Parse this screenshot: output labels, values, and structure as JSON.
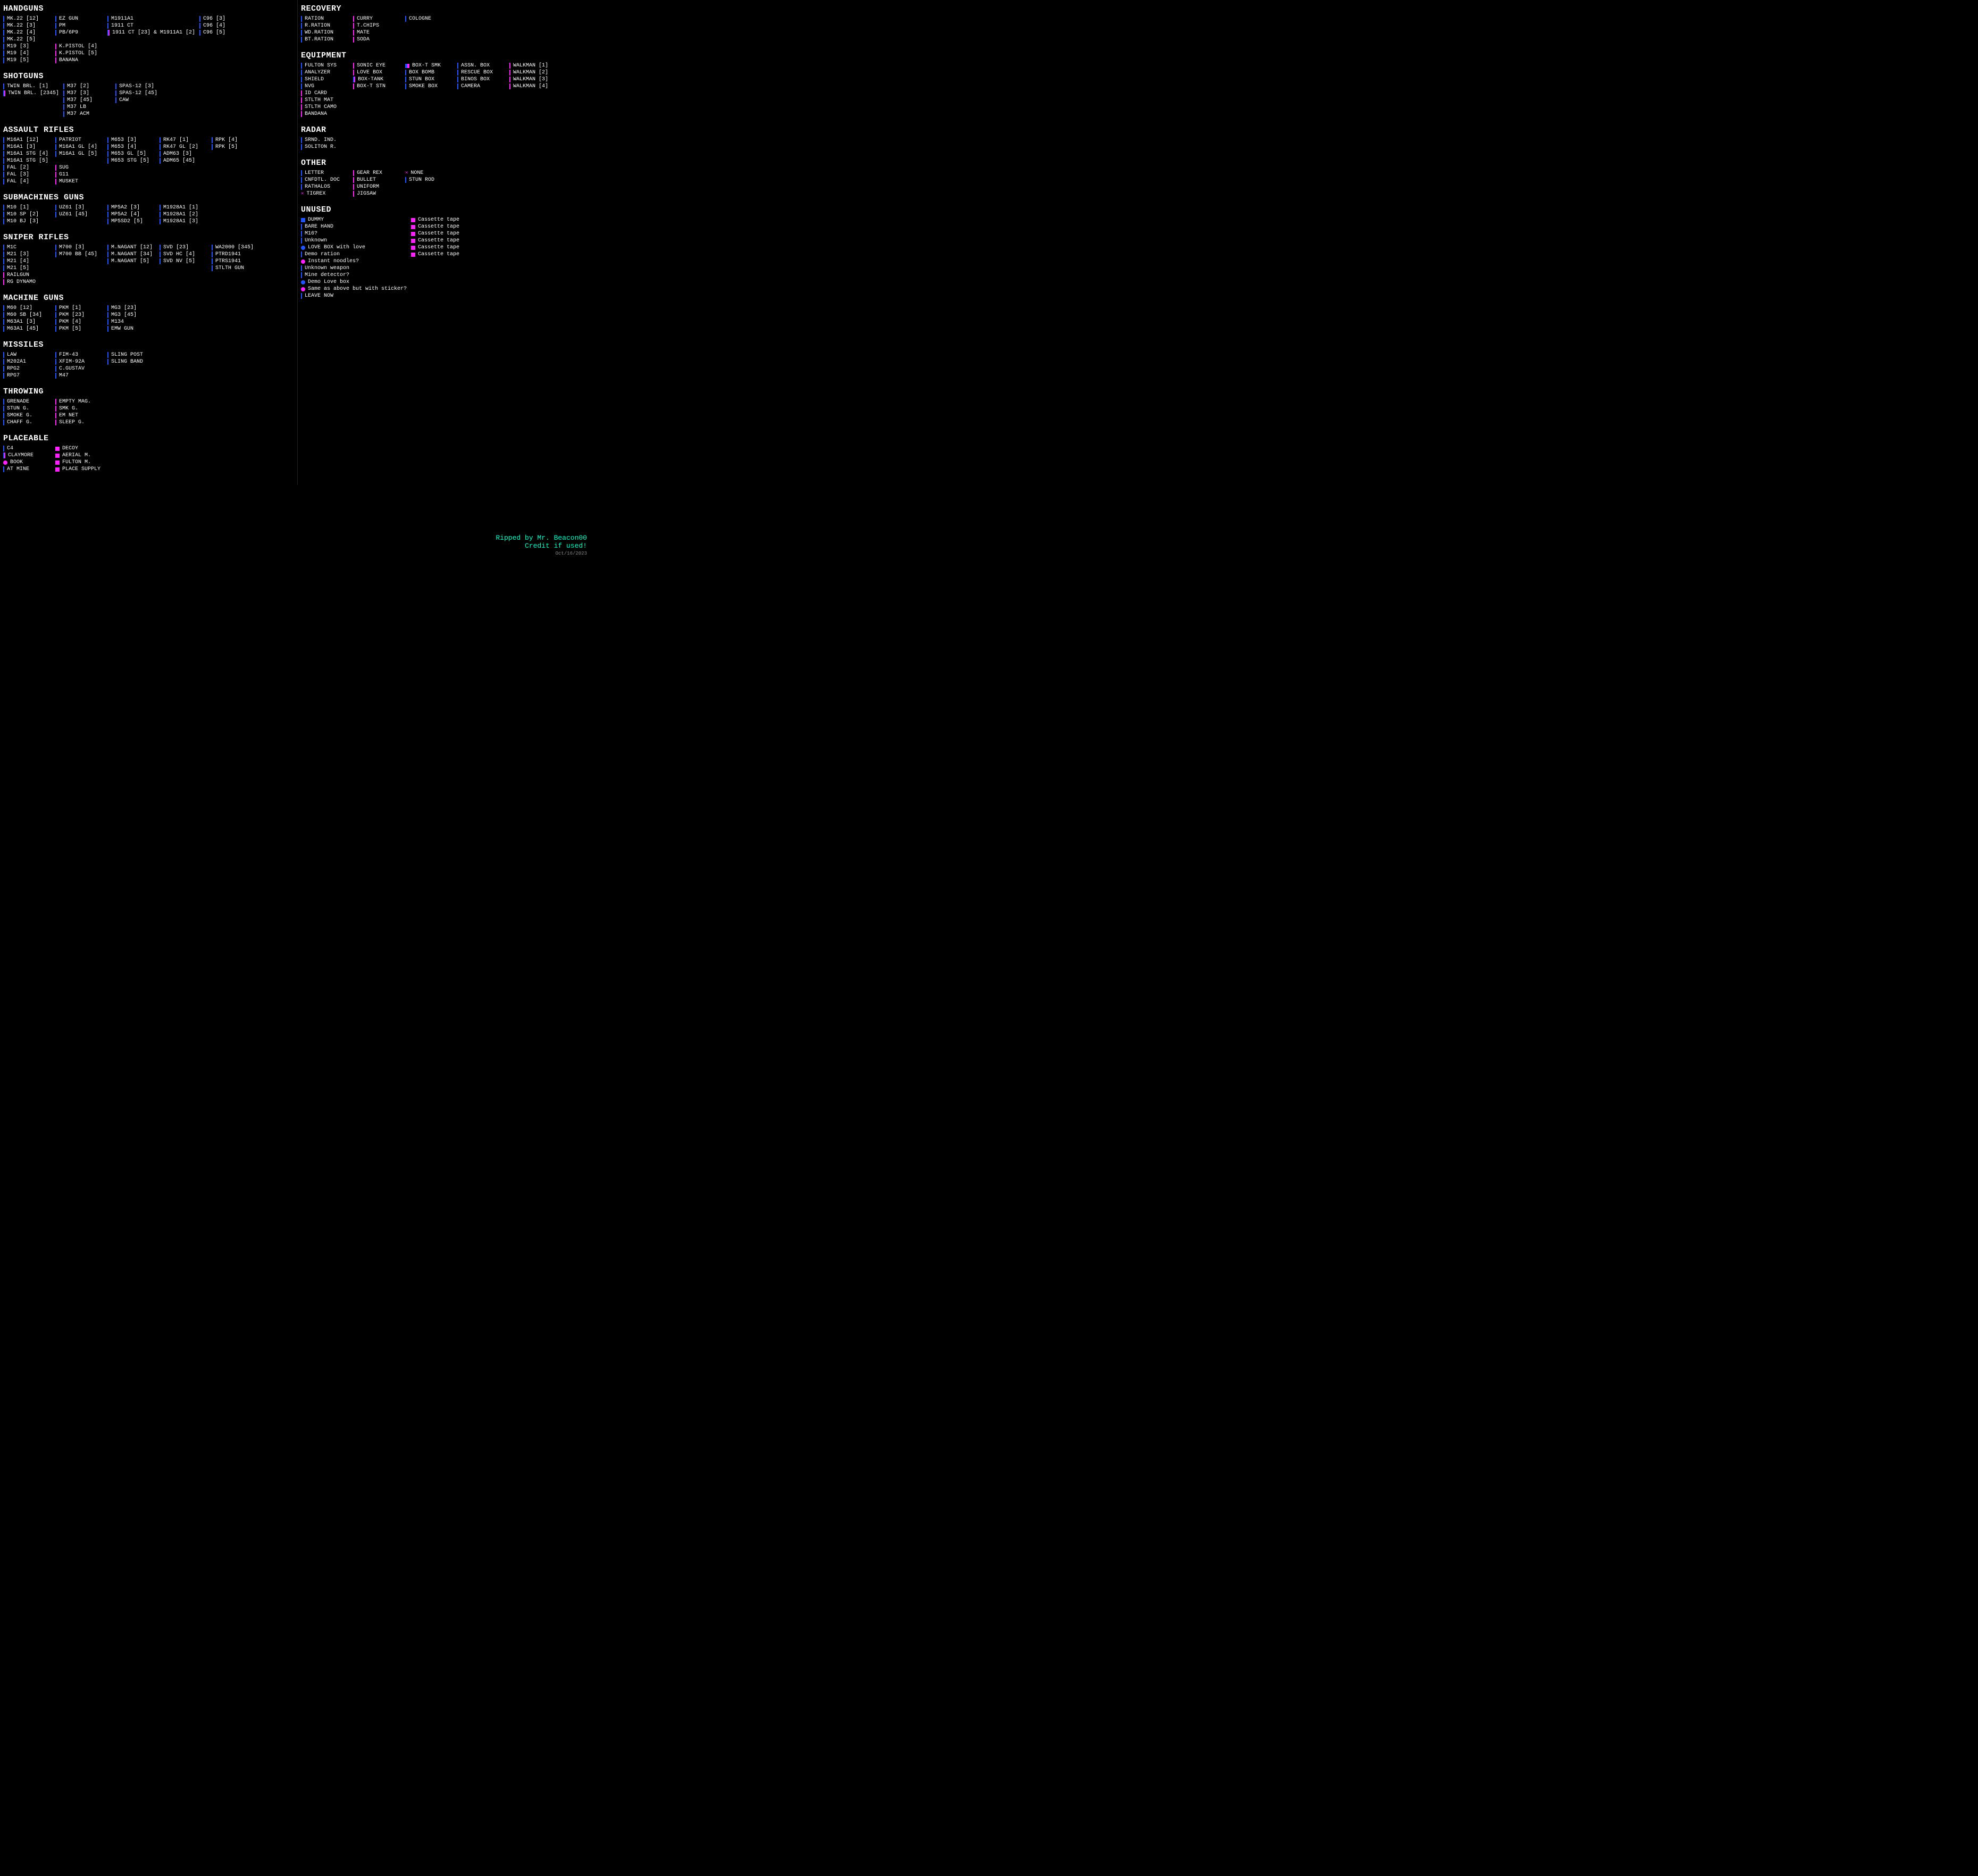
{
  "sections_left": [
    {
      "id": "handguns",
      "title": "HANDGUNS",
      "columns": [
        [
          {
            "icon": "b",
            "label": "MK.22 [12]"
          },
          {
            "icon": "b",
            "label": "MK.22 [3]"
          },
          {
            "icon": "b",
            "label": "MK.22 [4]"
          },
          {
            "icon": "b",
            "label": "MK.22 [5]"
          }
        ],
        [
          {
            "icon": "b",
            "label": "EZ GUN"
          },
          {
            "icon": "b",
            "label": "PM"
          },
          {
            "icon": "b",
            "label": "PB/6P9"
          }
        ],
        [
          {
            "icon": "b",
            "label": "M1911A1"
          },
          {
            "icon": "b",
            "label": "1911 CT"
          },
          {
            "icon": "bp",
            "label": "1911 CT [23] & M1911A1 [2]"
          }
        ],
        [
          {
            "icon": "b",
            "label": "C96 [3]"
          },
          {
            "icon": "b",
            "label": "C96 [4]"
          },
          {
            "icon": "b",
            "label": "C96 [5]"
          }
        ],
        [
          {
            "icon": "b",
            "label": "M19 [3]"
          },
          {
            "icon": "b",
            "label": "M19 [4]"
          },
          {
            "icon": "b",
            "label": "M19 [5]"
          }
        ],
        [
          {
            "icon": "p",
            "label": "K.PISTOL [4]"
          },
          {
            "icon": "p",
            "label": "K.PISTOL [5]"
          },
          {
            "icon": "p",
            "label": "BANANA"
          }
        ]
      ]
    },
    {
      "id": "shotguns",
      "title": "SHOTGUNS",
      "columns": [
        [
          {
            "icon": "b",
            "label": "TWIN BRL. [1]"
          },
          {
            "icon": "bp",
            "label": "TWIN BRL. [2345]"
          }
        ],
        [
          {
            "icon": "b",
            "label": "M37 [2]"
          },
          {
            "icon": "b",
            "label": "M37 [3]"
          },
          {
            "icon": "b",
            "label": "M37 [45]"
          },
          {
            "icon": "b",
            "label": "M37 LB"
          },
          {
            "icon": "b",
            "label": "M37 ACM"
          }
        ],
        [
          {
            "icon": "b",
            "label": "SPAS-12 [3]"
          },
          {
            "icon": "b",
            "label": "SPAS-12 [45]"
          },
          {
            "icon": "b",
            "label": "CAW"
          }
        ]
      ]
    },
    {
      "id": "assault-rifles",
      "title": "ASSAULT RIFLES",
      "columns": [
        [
          {
            "icon": "b",
            "label": "M16A1 [12]"
          },
          {
            "icon": "b",
            "label": "M16A1 [3]"
          },
          {
            "icon": "b",
            "label": "M16A1 STG [4]"
          },
          {
            "icon": "b",
            "label": "M16A1 STG [5]"
          }
        ],
        [
          {
            "icon": "b",
            "label": "PATRIOT"
          },
          {
            "icon": "b",
            "label": "M16A1 GL [4]"
          },
          {
            "icon": "b",
            "label": "M16A1 GL [5]"
          }
        ],
        [
          {
            "icon": "b",
            "label": "M653 [3]"
          },
          {
            "icon": "b",
            "label": "M653 [4]"
          },
          {
            "icon": "b",
            "label": "M653 GL [5]"
          },
          {
            "icon": "b",
            "label": "M653 STG [5]"
          }
        ],
        [
          {
            "icon": "b",
            "label": "RK47 [1]"
          },
          {
            "icon": "b",
            "label": "RK47 GL [2]"
          },
          {
            "icon": "b",
            "label": "ADM63 [3]"
          },
          {
            "icon": "b",
            "label": "ADM65 [45]"
          }
        ],
        [
          {
            "icon": "b",
            "label": "RPK [4]"
          },
          {
            "icon": "b",
            "label": "RPK [5]"
          }
        ],
        [
          {
            "icon": "b",
            "label": "FAL [2]"
          },
          {
            "icon": "b",
            "label": "FAL [3]"
          },
          {
            "icon": "b",
            "label": "FAL [4]"
          }
        ],
        [
          {
            "icon": "p",
            "label": "SUG"
          },
          {
            "icon": "p",
            "label": "G11"
          },
          {
            "icon": "p",
            "label": "MUSKET"
          }
        ]
      ]
    },
    {
      "id": "submachine-guns",
      "title": "SUBMACHINES GUNS",
      "columns": [
        [
          {
            "icon": "b",
            "label": "M10 [1]"
          },
          {
            "icon": "b",
            "label": "M10 SP [2]"
          },
          {
            "icon": "b",
            "label": "M10 BJ [3]"
          }
        ],
        [
          {
            "icon": "b",
            "label": "UZ61 [3]"
          },
          {
            "icon": "b",
            "label": "UZ61 [45]"
          }
        ],
        [
          {
            "icon": "b",
            "label": "MP5A2 [3]"
          },
          {
            "icon": "b",
            "label": "MP5A2 [4]"
          },
          {
            "icon": "b",
            "label": "MP5SD2 [5]"
          }
        ],
        [
          {
            "icon": "b",
            "label": "M1928A1 [1]"
          },
          {
            "icon": "b",
            "label": "M1928A1 [2]"
          },
          {
            "icon": "b",
            "label": "M1928A1 [3]"
          }
        ]
      ]
    },
    {
      "id": "sniper-rifles",
      "title": "SNIPER RIFLES",
      "columns": [
        [
          {
            "icon": "b",
            "label": "M1C"
          },
          {
            "icon": "b",
            "label": "M21 [3]"
          },
          {
            "icon": "b",
            "label": "M21 [4]"
          },
          {
            "icon": "b",
            "label": "M21 [5]"
          }
        ],
        [
          {
            "icon": "b",
            "label": "M700 [3]"
          },
          {
            "icon": "b",
            "label": "M700 BB [45]"
          }
        ],
        [
          {
            "icon": "b",
            "label": "M.NAGANT [12]"
          },
          {
            "icon": "b",
            "label": "M.NAGANT [34]"
          },
          {
            "icon": "b",
            "label": "M.NAGANT [5]"
          }
        ],
        [
          {
            "icon": "b",
            "label": "SVD [23]"
          },
          {
            "icon": "b",
            "label": "SVD HC [4]"
          },
          {
            "icon": "b",
            "label": "SVD NV [5]"
          }
        ],
        [
          {
            "icon": "b",
            "label": "WA2000 [345]"
          },
          {
            "icon": "b",
            "label": "PTRD1941"
          },
          {
            "icon": "b",
            "label": "PTRS1941"
          },
          {
            "icon": "b",
            "label": "STLTH GUN"
          }
        ],
        [
          {
            "icon": "p",
            "label": "RAILGUN"
          },
          {
            "icon": "p",
            "label": "RG DYNAMO"
          }
        ]
      ]
    },
    {
      "id": "machine-guns",
      "title": "MACHINE GUNS",
      "columns": [
        [
          {
            "icon": "b",
            "label": "M60 [12]"
          },
          {
            "icon": "b",
            "label": "M60 SB [34]"
          },
          {
            "icon": "b",
            "label": "M63A1 [3]"
          },
          {
            "icon": "b",
            "label": "M63A1 [45]"
          }
        ],
        [
          {
            "icon": "b",
            "label": "PKM [1]"
          },
          {
            "icon": "b",
            "label": "PKM [23]"
          },
          {
            "icon": "b",
            "label": "PKM [4]"
          },
          {
            "icon": "b",
            "label": "PKM [5]"
          }
        ],
        [
          {
            "icon": "b",
            "label": "MG3 [23]"
          },
          {
            "icon": "b",
            "label": "MG3 [45]"
          },
          {
            "icon": "b",
            "label": "M134"
          },
          {
            "icon": "b",
            "label": "EMW GUN"
          }
        ]
      ]
    },
    {
      "id": "missiles",
      "title": "MISSILES",
      "columns": [
        [
          {
            "icon": "b",
            "label": "LAW"
          },
          {
            "icon": "b",
            "label": "M202A1"
          },
          {
            "icon": "b",
            "label": "RPG2"
          },
          {
            "icon": "b",
            "label": "RPG7"
          }
        ],
        [
          {
            "icon": "b",
            "label": "FIM-43"
          },
          {
            "icon": "b",
            "label": "XFIM-92A"
          },
          {
            "icon": "b",
            "label": "C.GUSTAV"
          },
          {
            "icon": "b",
            "label": "M47"
          }
        ],
        [
          {
            "icon": "b",
            "label": "SLING POST"
          },
          {
            "icon": "b",
            "label": "SLING BAND"
          }
        ]
      ]
    },
    {
      "id": "throwing",
      "title": "THROWING",
      "columns": [
        [
          {
            "icon": "b",
            "label": "GRENADE"
          },
          {
            "icon": "b",
            "label": "STUN G."
          },
          {
            "icon": "b",
            "label": "SMOKE G."
          },
          {
            "icon": "b",
            "label": "CHAFF G."
          }
        ],
        [
          {
            "icon": "p",
            "label": "EMPTY MAG."
          },
          {
            "icon": "p",
            "label": "SMK G."
          },
          {
            "icon": "p",
            "label": "EM NET"
          },
          {
            "icon": "p",
            "label": "SLEEP G."
          }
        ]
      ]
    },
    {
      "id": "placeable",
      "title": "PLACEABLE",
      "columns": [
        [
          {
            "icon": "b",
            "label": "C4"
          },
          {
            "icon": "bp",
            "label": "CLAYMORE"
          },
          {
            "icon": "circ_p",
            "label": "BOOK"
          },
          {
            "icon": "b",
            "label": "AT MINE"
          }
        ],
        [
          {
            "icon": "sq_p",
            "label": "DECOY"
          },
          {
            "icon": "sq_p",
            "label": "AERIAL M."
          },
          {
            "icon": "sq_p",
            "label": "FULTON M."
          },
          {
            "icon": "sq_p",
            "label": "PLACE SUPPLY"
          }
        ]
      ]
    }
  ],
  "sections_right": [
    {
      "id": "recovery",
      "title": "RECOVERY",
      "columns": [
        [
          {
            "icon": "b",
            "label": "RATION"
          },
          {
            "icon": "b",
            "label": "R.RATION"
          },
          {
            "icon": "b",
            "label": "WD.RATION"
          },
          {
            "icon": "b",
            "label": "BT.RATION"
          }
        ],
        [
          {
            "icon": "p",
            "label": "CURRY"
          },
          {
            "icon": "p",
            "label": "T.CHIPS"
          },
          {
            "icon": "p",
            "label": "MATE"
          },
          {
            "icon": "p",
            "label": "SODA"
          }
        ],
        [
          {
            "icon": "b",
            "label": "COLOGNE"
          }
        ]
      ]
    },
    {
      "id": "equipment",
      "title": "EQUIPMENT",
      "columns": [
        [
          {
            "icon": "b",
            "label": "FULTON SYS"
          },
          {
            "icon": "b",
            "label": "ANALYZER"
          },
          {
            "icon": "b",
            "label": "SHIELD"
          },
          {
            "icon": "b",
            "label": "NVG"
          }
        ],
        [
          {
            "icon": "p",
            "label": "SONIC EYE"
          },
          {
            "icon": "p",
            "label": "LOVE BOX"
          },
          {
            "icon": "bp",
            "label": "BOX-TANK"
          },
          {
            "icon": "p",
            "label": "BOX-T STN"
          }
        ],
        [
          {
            "icon": "sq_bp",
            "label": "BOX-T SMK"
          },
          {
            "icon": "b",
            "label": "BOX BOMB"
          },
          {
            "icon": "b",
            "label": "STUN BOX"
          },
          {
            "icon": "b",
            "label": "SMOKE BOX"
          }
        ],
        [
          {
            "icon": "b",
            "label": "ASSN. BOX"
          },
          {
            "icon": "b",
            "label": "RESCUE BOX"
          },
          {
            "icon": "b",
            "label": "BINOS BOX"
          },
          {
            "icon": "b",
            "label": "CAMERA"
          }
        ],
        [
          {
            "icon": "p",
            "label": "WALKMAN [1]"
          },
          {
            "icon": "p",
            "label": "WALKMAN [2]"
          },
          {
            "icon": "p",
            "label": "WALKMAN [3]"
          },
          {
            "icon": "p",
            "label": "WALKMAN [4]"
          }
        ],
        [
          {
            "icon": "p",
            "label": "ID CARD"
          },
          {
            "icon": "p",
            "label": "STLTH MAT"
          },
          {
            "icon": "p",
            "label": "STLTH CAMO"
          },
          {
            "icon": "p",
            "label": "BANDANA"
          }
        ]
      ]
    },
    {
      "id": "radar",
      "title": "RADAR",
      "columns": [
        [
          {
            "icon": "b",
            "label": "SRND. IND."
          },
          {
            "icon": "b",
            "label": "SOLITON R."
          }
        ]
      ]
    },
    {
      "id": "other",
      "title": "OTHER",
      "columns": [
        [
          {
            "icon": "b",
            "label": "LETTER"
          },
          {
            "icon": "b",
            "label": "CNFDTL. DOC"
          },
          {
            "icon": "b",
            "label": "RATHALOS"
          },
          {
            "icon": "x",
            "label": "TIGREX"
          }
        ],
        [
          {
            "icon": "p",
            "label": "GEAR REX"
          },
          {
            "icon": "p",
            "label": "BULLET"
          },
          {
            "icon": "p",
            "label": "UNIFORM"
          },
          {
            "icon": "p",
            "label": "JIGSAW"
          }
        ],
        [
          {
            "icon": "x",
            "label": "NONE"
          },
          {
            "icon": "b",
            "label": "STUN ROD"
          }
        ]
      ]
    },
    {
      "id": "unused",
      "title": "UNUSED",
      "columns": [
        [
          {
            "icon": "sq_b",
            "label": "DUMMY"
          },
          {
            "icon": "b",
            "label": "BARE HAND"
          },
          {
            "icon": "b",
            "label": "M16?"
          },
          {
            "icon": "b",
            "label": "Unknown"
          },
          {
            "icon": "circ_b",
            "label": "LOVE BOX with love"
          },
          {
            "icon": "b",
            "label": "Demo ration"
          },
          {
            "icon": "circ_p",
            "label": "Instant noodles?"
          },
          {
            "icon": "b",
            "label": "Unknown weapon"
          },
          {
            "icon": "b",
            "label": "Mine detector?"
          },
          {
            "icon": "circ_b",
            "label": "Demo Love box"
          },
          {
            "icon": "circ_p",
            "label": "Same as above but with sticker?"
          },
          {
            "icon": "b",
            "label": "LEAVE NOW"
          }
        ],
        [
          {
            "icon": "sq_p",
            "label": "Cassette tape"
          },
          {
            "icon": "sq_p",
            "label": "Cassette tape"
          },
          {
            "icon": "sq_p",
            "label": "Cassette tape"
          },
          {
            "icon": "sq_p",
            "label": "Cassette tape"
          },
          {
            "icon": "sq_p",
            "label": "Cassette tape"
          },
          {
            "icon": "sq_p",
            "label": "Cassette tape"
          }
        ]
      ]
    }
  ],
  "footer": {
    "credit": "Ripped by Mr. Beacon00\nCredit if used!",
    "date": "Oct/16/2023"
  }
}
